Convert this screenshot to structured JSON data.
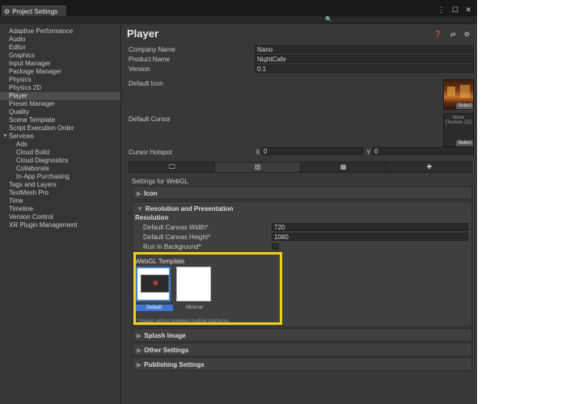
{
  "window": {
    "tab_title": "Project Settings",
    "controls": "⋮ ☐ ✕"
  },
  "search": {
    "icon": "🔍"
  },
  "sidebar": {
    "items": [
      {
        "label": "Adaptive Performance",
        "selected": false,
        "sub": false
      },
      {
        "label": "Audio",
        "selected": false,
        "sub": false
      },
      {
        "label": "Editor",
        "selected": false,
        "sub": false
      },
      {
        "label": "Graphics",
        "selected": false,
        "sub": false
      },
      {
        "label": "Input Manager",
        "selected": false,
        "sub": false
      },
      {
        "label": "Package Manager",
        "selected": false,
        "sub": false
      },
      {
        "label": "Physics",
        "selected": false,
        "sub": false
      },
      {
        "label": "Physics 2D",
        "selected": false,
        "sub": false
      },
      {
        "label": "Player",
        "selected": true,
        "sub": false
      },
      {
        "label": "Preset Manager",
        "selected": false,
        "sub": false
      },
      {
        "label": "Quality",
        "selected": false,
        "sub": false
      },
      {
        "label": "Scene Template",
        "selected": false,
        "sub": false
      },
      {
        "label": "Script Execution Order",
        "selected": false,
        "sub": false
      },
      {
        "label": "Services",
        "selected": false,
        "sub": false,
        "expanded": true
      },
      {
        "label": "Ads",
        "selected": false,
        "sub": true
      },
      {
        "label": "Cloud Build",
        "selected": false,
        "sub": true
      },
      {
        "label": "Cloud Diagnostics",
        "selected": false,
        "sub": true
      },
      {
        "label": "Collaborate",
        "selected": false,
        "sub": true
      },
      {
        "label": "In-App Purchasing",
        "selected": false,
        "sub": true
      },
      {
        "label": "Tags and Layers",
        "selected": false,
        "sub": false
      },
      {
        "label": "TextMesh Pro",
        "selected": false,
        "sub": false
      },
      {
        "label": "Time",
        "selected": false,
        "sub": false
      },
      {
        "label": "Timeline",
        "selected": false,
        "sub": false
      },
      {
        "label": "Version Control",
        "selected": false,
        "sub": false
      },
      {
        "label": "XR Plugin Management",
        "selected": false,
        "sub": false
      }
    ]
  },
  "player": {
    "title": "Player",
    "header_icons": "❓ ⇄ ⚙",
    "company_name_label": "Company Name",
    "company_name_value": "Nano",
    "product_name_label": "Product Name",
    "product_name_value": "NightCafe",
    "version_label": "Version",
    "version_value": "0.1",
    "default_icon_label": "Default Icon",
    "icon_select": "Select",
    "default_cursor_label": "Default Cursor",
    "cursor_none": "None",
    "cursor_type": "(Texture 2D)",
    "cursor_select": "Select",
    "cursor_hotspot_label": "Cursor Hotspot",
    "hotspot_x_label": "X",
    "hotspot_x_value": "0",
    "hotspot_y_label": "Y",
    "hotspot_y_value": "0"
  },
  "platform_tabs": [
    {
      "icon": "monitor-icon",
      "glyph": "🖵",
      "selected": false
    },
    {
      "icon": "webgl-icon",
      "glyph": "▥",
      "selected": true
    },
    {
      "icon": "windows-icon",
      "glyph": "▦",
      "selected": false
    },
    {
      "icon": "android-icon",
      "glyph": "✚",
      "selected": false
    }
  ],
  "settings_for": "Settings for WebGL",
  "sections": {
    "icon": "Icon",
    "resolution": "Resolution and Presentation",
    "splash": "Splash Image",
    "other": "Other Settings",
    "publishing": "Publishing Settings"
  },
  "resolution": {
    "heading": "Resolution",
    "canvas_width_label": "Default Canvas Width*",
    "canvas_width_value": "720",
    "canvas_height_label": "Default Canvas Height*",
    "canvas_height_value": "1080",
    "run_in_background_label": "Run In Background*",
    "run_in_background": false,
    "webgl_template_heading": "WebGL Template",
    "templates": [
      {
        "name": "Default",
        "selected": true
      },
      {
        "name": "Minimal",
        "selected": false
      }
    ],
    "shared_note": "* Shared setting between multiple platforms."
  },
  "colors": {
    "highlight": "#f2cf1b",
    "selected_template": "#3d75d6"
  }
}
